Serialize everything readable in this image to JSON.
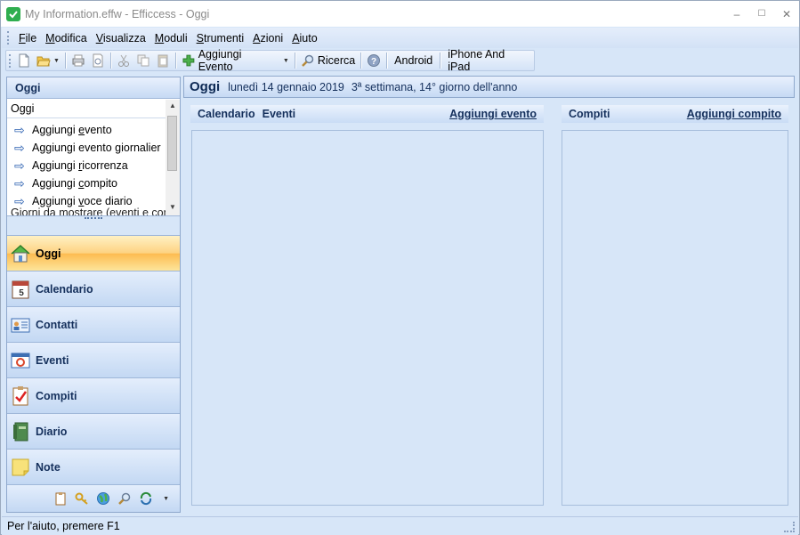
{
  "window": {
    "title": "My Information.effw - Efficcess - Oggi",
    "controls": {
      "minimize": "–",
      "maximize": "☐",
      "close": "✕"
    }
  },
  "menu": [
    {
      "label": "File",
      "key": "F",
      "rest": "ile"
    },
    {
      "label": "Modifica",
      "key": "M",
      "rest": "odifica"
    },
    {
      "label": "Visualizza",
      "key": "V",
      "rest": "isualizza"
    },
    {
      "label": "Moduli",
      "key": "M",
      "rest": "oduli"
    },
    {
      "label": "Strumenti",
      "key": "S",
      "rest": "trumenti"
    },
    {
      "label": "Azioni",
      "key": "A",
      "rest": "zioni"
    },
    {
      "label": "Aiuto",
      "key": "A",
      "rest": "iuto"
    }
  ],
  "toolbar": {
    "add_event_label": "Aggiungi Evento",
    "search_label": "Ricerca",
    "android_label": "Android",
    "iphone_label": "iPhone And iPad"
  },
  "left_pane": {
    "header": "Oggi",
    "task_title": "Oggi",
    "tasks": [
      {
        "pre": "Aggiungi ",
        "key": "e",
        "post": "vento"
      },
      {
        "pre": "Aggiungi evento ",
        "key": "g",
        "post": "iornalier"
      },
      {
        "pre": "Aggiungi ",
        "key": "r",
        "post": "icorrenza"
      },
      {
        "pre": "Aggiungi ",
        "key": "c",
        "post": "ompito"
      },
      {
        "pre": "Aggiungi ",
        "key": "v",
        "post": "oce diario"
      }
    ],
    "task_footer": "Giorni da mostrare (eventi e com",
    "nav": [
      "Oggi",
      "Calendario",
      "Contatti",
      "Eventi",
      "Compiti",
      "Diario",
      "Note"
    ],
    "active_nav": "Oggi"
  },
  "today": {
    "title": "Oggi",
    "date": "lunedì 14 gennaio 2019",
    "week": "3ª settimana, 14° giorno dell'anno"
  },
  "events_panel": {
    "col1": "Calendario",
    "col2": "Eventi",
    "action": "Aggiungi evento"
  },
  "tasks_panel": {
    "title": "Compiti",
    "action": "Aggiungi compito"
  },
  "status": {
    "text": "Per l'aiuto, premere F1"
  },
  "colors": {
    "accent": "#2fae4f",
    "panel_bg": "#d7e6f8",
    "header_text": "#15305c",
    "active_nav": "#fdbb4f"
  }
}
